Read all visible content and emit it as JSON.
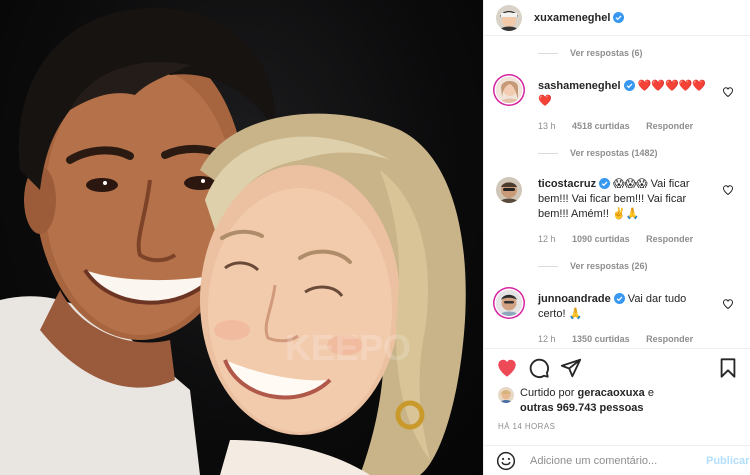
{
  "post": {
    "author": "xuxameneghel",
    "photo_watermark": "KEEPO"
  },
  "comments": [
    {
      "view_replies": "Ver respostas (6)"
    },
    {
      "username": "sashameneghel",
      "text": "❤️❤️❤️❤️❤️❤️",
      "time": "13 h",
      "likes": "4518 curtidas",
      "reply": "Responder",
      "view_replies": "Ver respostas (1482)"
    },
    {
      "username": "ticostacruz",
      "text": "😱😱😱 Vai ficar bem!!! Vai ficar bem!!! Vai ficar bem!!! Amém!! ✌️🙏",
      "time": "12 h",
      "likes": "1090 curtidas",
      "reply": "Responder",
      "view_replies": "Ver respostas (26)"
    },
    {
      "username": "junnoandrade",
      "text": "Vai dar tudo certo! 🙏",
      "time": "12 h",
      "likes": "1350 curtidas",
      "reply": "Responder"
    }
  ],
  "likes": {
    "prefix": "Curtido por",
    "liker": "geracaoxuxa",
    "and": "e",
    "others": "outras 969.743 pessoas"
  },
  "timestamp": "HÁ 14 HORAS",
  "add_comment": {
    "placeholder": "Adicione um comentário...",
    "post_label": "Publicar"
  },
  "colors": {
    "verified": "#3897f0",
    "liked_heart": "#ed4956",
    "story_ring": "#d6249f",
    "post_disabled": "#b2dffc",
    "muted_text": "#8e8e8e"
  },
  "icons": [
    "verified-icon",
    "heart-icon",
    "comment-icon",
    "share-icon",
    "bookmark-icon",
    "emoji-icon"
  ]
}
